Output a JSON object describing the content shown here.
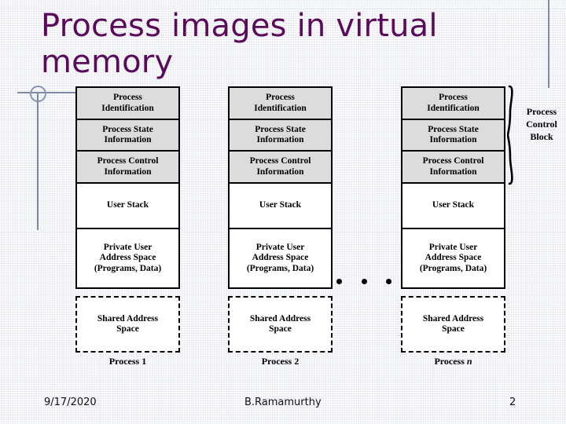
{
  "slide": {
    "title": "Process images in virtual\nmemory",
    "title_color": "#5b0a5b",
    "accent_rule_color": "#7b8aa6",
    "shaded_block_color": "#dcdcdc"
  },
  "diagram": {
    "ellipsis": "• • •",
    "pcb_bracket_label": "Process\nControl\nBlock",
    "columns": [
      {
        "blocks": [
          {
            "label": "Process\nIdentification",
            "shaded": true
          },
          {
            "label": "Process State\nInformation",
            "shaded": true
          },
          {
            "label": "Process Control\nInformation",
            "shaded": true
          },
          {
            "label": "User Stack",
            "shaded": false
          },
          {
            "label": "Private User\nAddress Space\n(Programs, Data)",
            "shaded": false
          }
        ],
        "shared_block": "Shared Address\nSpace",
        "caption": "Process 1",
        "caption_italic_suffix": ""
      },
      {
        "blocks": [
          {
            "label": "Process\nIdentification",
            "shaded": true
          },
          {
            "label": "Process State\nInformation",
            "shaded": true
          },
          {
            "label": "Process Control\nInformation",
            "shaded": true
          },
          {
            "label": "User Stack",
            "shaded": false
          },
          {
            "label": "Private User\nAddress Space\n(Programs, Data)",
            "shaded": false
          }
        ],
        "shared_block": "Shared Address\nSpace",
        "caption": "Process 2",
        "caption_italic_suffix": ""
      },
      {
        "blocks": [
          {
            "label": "Process\nIdentification",
            "shaded": true
          },
          {
            "label": "Process State\nInformation",
            "shaded": true
          },
          {
            "label": "Process Control\nInformation",
            "shaded": true
          },
          {
            "label": "User Stack",
            "shaded": false
          },
          {
            "label": "Private User\nAddress Space\n(Programs, Data)",
            "shaded": false
          }
        ],
        "shared_block": "Shared Address\nSpace",
        "caption": "Process ",
        "caption_italic_suffix": "n"
      }
    ]
  },
  "footer": {
    "date": "9/17/2020",
    "author": "B.Ramamurthy",
    "page_number": "2"
  }
}
